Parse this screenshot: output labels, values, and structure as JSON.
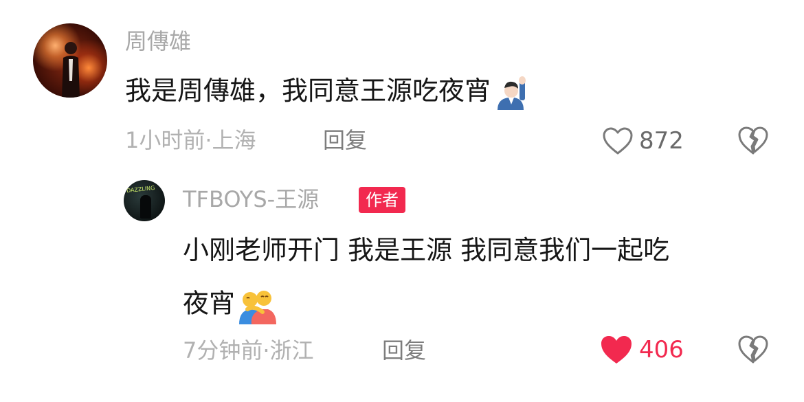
{
  "comments": [
    {
      "username": "周傳雄",
      "text": "我是周傳雄，我同意王源吃夜宵",
      "emoji": "person-raising-hand-emoji",
      "time": "1小时前·上海",
      "reply_label": "回复",
      "likes": "872",
      "liked": false
    },
    {
      "username": "TFBOYS-王源",
      "badge": "作者",
      "text_line1": "小刚老师开门 我是王源 我同意我们一起吃",
      "text_line2": "夜宵",
      "emoji": "people-hugging-emoji",
      "time": "7分钟前·浙江",
      "reply_label": "回复",
      "likes": "406",
      "liked": true
    }
  ],
  "colors": {
    "accent": "#f2294f",
    "username": "#a8a8a8",
    "meta": "#b1b1b1",
    "text": "#161616"
  }
}
